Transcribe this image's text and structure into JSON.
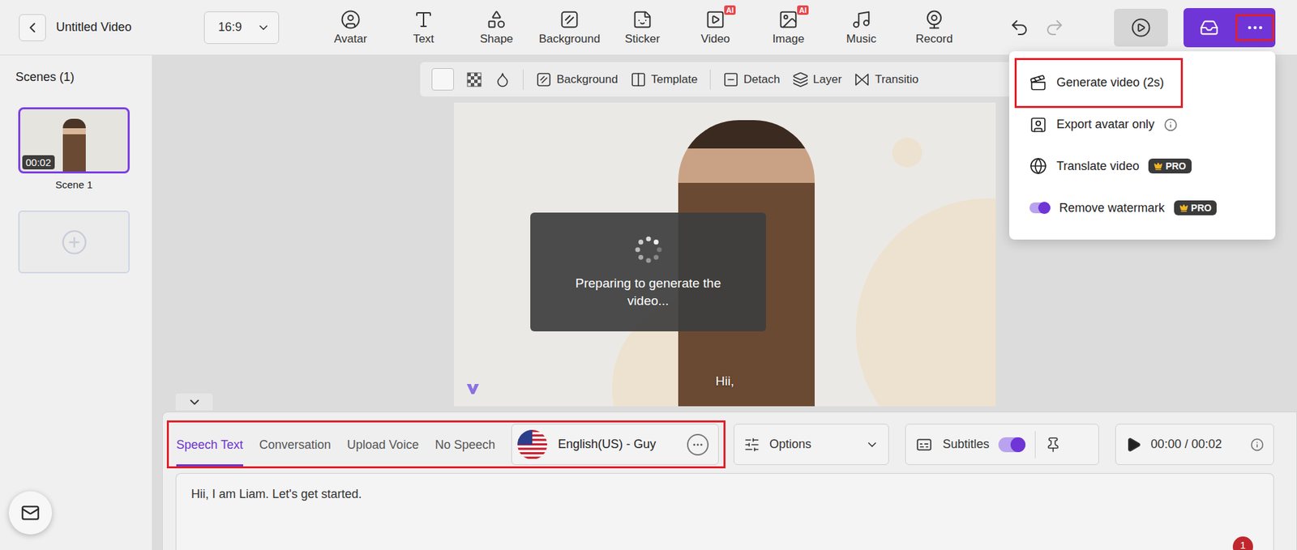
{
  "header": {
    "title": "Untitled Video",
    "ratio": "16:9",
    "tools": [
      {
        "label": "Avatar",
        "badge": null
      },
      {
        "label": "Text",
        "badge": null
      },
      {
        "label": "Shape",
        "badge": null
      },
      {
        "label": "Background",
        "badge": null
      },
      {
        "label": "Sticker",
        "badge": null
      },
      {
        "label": "Video",
        "badge": "AI"
      },
      {
        "label": "Image",
        "badge": "AI"
      },
      {
        "label": "Music",
        "badge": null
      },
      {
        "label": "Record",
        "badge": null
      }
    ],
    "more_button": {
      "highlighted": true
    }
  },
  "sidebar": {
    "title": "Scenes (1)",
    "scenes": [
      {
        "name": "Scene 1",
        "duration": "00:02",
        "selected": true
      }
    ]
  },
  "canvas_toolbar": {
    "items": [
      "Background",
      "Template",
      "Detach",
      "Layer",
      "Transitio"
    ]
  },
  "canvas": {
    "subtitle": "Hii,",
    "loading": {
      "message": "Preparing to generate the video..."
    }
  },
  "speech_panel": {
    "highlighted": true,
    "tabs": [
      {
        "label": "Speech Text",
        "selected": true
      },
      {
        "label": "Conversation",
        "selected": false
      },
      {
        "label": "Upload Voice",
        "selected": false
      },
      {
        "label": "No Speech",
        "selected": false
      }
    ],
    "voice": "English(US) - Guy",
    "options": "Options",
    "subtitles": {
      "label": "Subtitles",
      "on": true
    },
    "time": "00:00 / 00:02",
    "text": "Hii, I am Liam. Let's get started.",
    "badge": "1"
  },
  "menu": {
    "items": [
      {
        "label": "Generate video (2s)",
        "kind": "action",
        "highlighted": true
      },
      {
        "label": "Export avatar only",
        "kind": "info",
        "highlighted": false
      },
      {
        "label": "Translate video",
        "kind": "pro",
        "highlighted": false,
        "badge": "PRO"
      },
      {
        "label": "Remove watermark",
        "kind": "toggle",
        "highlighted": false,
        "on": true,
        "badge": "PRO"
      }
    ]
  }
}
